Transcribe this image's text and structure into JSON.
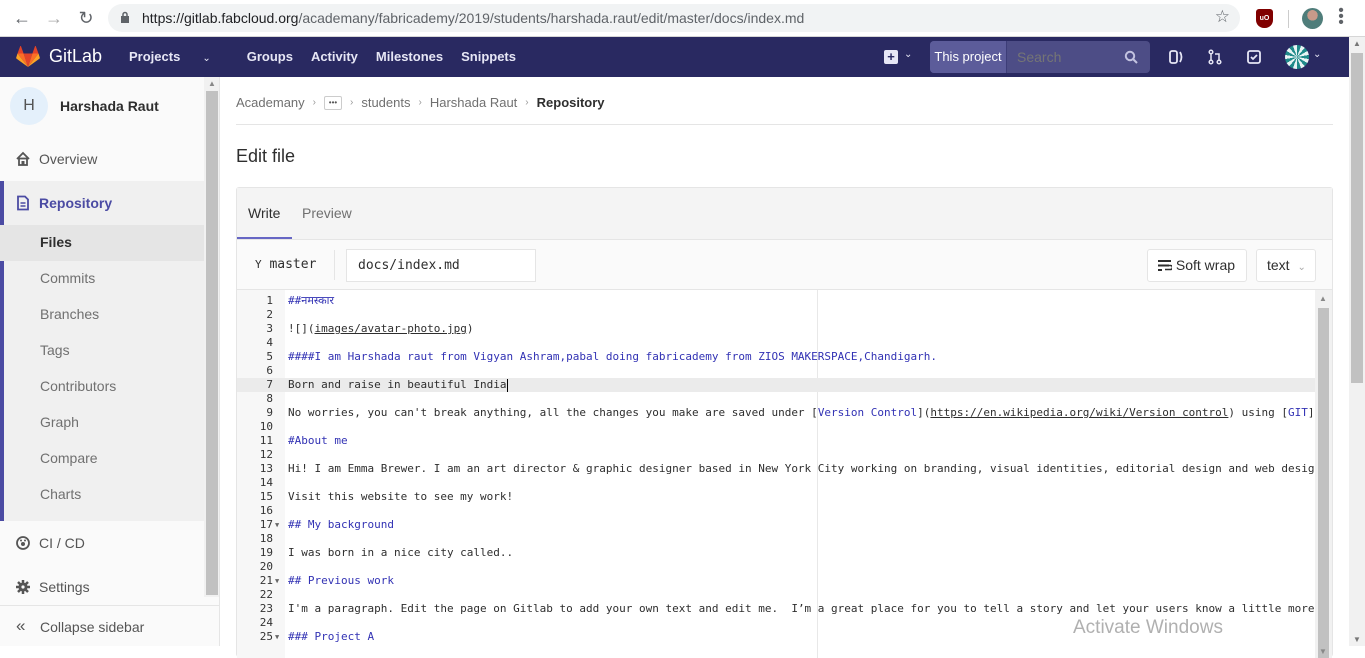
{
  "browser": {
    "url_host": "https://gitlab.fabcloud.org",
    "url_path": "/academany/fabricademy/2019/students/harshada.raut/edit/master/docs/index.md",
    "extension_label": "uO"
  },
  "header": {
    "brand": "GitLab",
    "nav": [
      {
        "label": "Projects",
        "has_dropdown": true
      },
      {
        "label": "Groups"
      },
      {
        "label": "Activity"
      },
      {
        "label": "Milestones"
      },
      {
        "label": "Snippets"
      }
    ],
    "search_scope": "This project",
    "search_placeholder": "Search",
    "colors": {
      "header_bg": "#292961",
      "accent": "#6666c4"
    }
  },
  "sidebar": {
    "context_initial": "H",
    "context_name": "Harshada Raut",
    "overview": "Overview",
    "repository": "Repository",
    "repo_items": [
      {
        "label": "Files",
        "active": true
      },
      {
        "label": "Commits"
      },
      {
        "label": "Branches"
      },
      {
        "label": "Tags"
      },
      {
        "label": "Contributors"
      },
      {
        "label": "Graph"
      },
      {
        "label": "Compare"
      },
      {
        "label": "Charts"
      }
    ],
    "cicd": "CI / CD",
    "settings": "Settings",
    "collapse": "Collapse sidebar"
  },
  "breadcrumb": {
    "items": [
      "Academany",
      "students",
      "Harshada Raut"
    ],
    "current": "Repository"
  },
  "page": {
    "title": "Edit file"
  },
  "editor": {
    "tabs": [
      {
        "label": "Write",
        "active": true
      },
      {
        "label": "Preview"
      }
    ],
    "branch": "master",
    "file_path": "docs/index.md",
    "soft_wrap_label": "Soft wrap",
    "language": "text",
    "current_line": 7,
    "lines": [
      {
        "n": "1",
        "text": "##नमस्कार",
        "kind": "heading"
      },
      {
        "n": "2",
        "text": ""
      },
      {
        "n": "3",
        "pre": "![](",
        "link": "images/avatar-photo.jpg",
        "post": ")"
      },
      {
        "n": "4",
        "text": ""
      },
      {
        "n": "5",
        "text": "####I am Harshada raut from Vigyan Ashram,pabal doing fabricademy from ZIOS MAKERSPACE,Chandigarh.",
        "kind": "heading"
      },
      {
        "n": "6",
        "text": ""
      },
      {
        "n": "7",
        "text": "Born and raise in beautiful India"
      },
      {
        "n": "8",
        "text": ""
      },
      {
        "n": "9",
        "pre": "No worries, you can't break anything, all the changes you make are saved under [",
        "linktext": "Version Control",
        "mid": "](",
        "link": "https://en.wikipedia.org/wiki/Version control",
        "post": ") using [",
        "linktext2": "GIT",
        "post2": "]("
      },
      {
        "n": "10",
        "text": ""
      },
      {
        "n": "11",
        "text": "#About me",
        "kind": "heading"
      },
      {
        "n": "12",
        "text": ""
      },
      {
        "n": "13",
        "text": "Hi! I am Emma Brewer. I am an art director & graphic designer based in New York City working on branding, visual identities, editorial design and web desigr"
      },
      {
        "n": "14",
        "text": ""
      },
      {
        "n": "15",
        "text": "Visit this website to see my work!"
      },
      {
        "n": "16",
        "text": ""
      },
      {
        "n": "17",
        "text": "## My background",
        "kind": "heading",
        "fold": true
      },
      {
        "n": "18",
        "text": ""
      },
      {
        "n": "19",
        "text": "I was born in a nice city called.."
      },
      {
        "n": "20",
        "text": ""
      },
      {
        "n": "21",
        "text": "## Previous work",
        "kind": "heading",
        "fold": true
      },
      {
        "n": "22",
        "text": ""
      },
      {
        "n": "23",
        "text": "I'm a paragraph. Edit the page on Gitlab to add your own text and edit me.  I’m a great place for you to tell a story and let your users know a little more"
      },
      {
        "n": "24",
        "text": ""
      },
      {
        "n": "25",
        "text": "### Project A",
        "kind": "heading",
        "fold": true
      }
    ]
  },
  "os": {
    "watermark": "Activate Windows"
  }
}
